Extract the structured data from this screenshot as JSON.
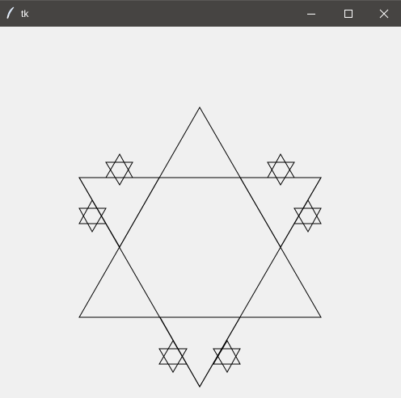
{
  "window": {
    "title": "tk",
    "icon": "feather-icon",
    "controls": {
      "minimize_icon": "minimize-icon",
      "maximize_icon": "maximize-icon",
      "close_icon": "close-icon"
    },
    "titlebar_color": "#464442",
    "background_color": "#f0f0f0"
  },
  "drawing": {
    "shape": "koch-snowflake",
    "stroke_color": "#000000"
  }
}
